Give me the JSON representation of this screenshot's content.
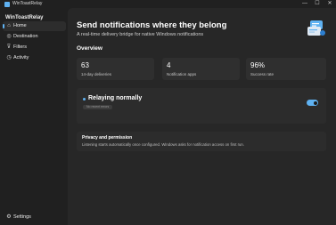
{
  "window": {
    "title": "WinToastRelay",
    "minimize_glyph": "—",
    "maximize_glyph": "☐",
    "close_glyph": "✕"
  },
  "sidebar": {
    "brand": "WinToastRelay",
    "items": [
      {
        "label": "Home",
        "icon": "home-icon",
        "glyph": "⌂",
        "active": true
      },
      {
        "label": "Destination",
        "icon": "globe-icon",
        "glyph": "◎"
      },
      {
        "label": "Filters",
        "icon": "filter-icon",
        "glyph": "⊽"
      },
      {
        "label": "Activity",
        "icon": "activity-icon",
        "glyph": "◷"
      }
    ],
    "footer": {
      "label": "Settings",
      "icon": "gear-icon",
      "glyph": "⚙"
    }
  },
  "main": {
    "headline": "Send notifications where they belong",
    "subhead": "A real-time delivery bridge for native Windows notifications",
    "overview_title": "Overview",
    "stats": [
      {
        "value": "63",
        "caption": "14-day deliveries"
      },
      {
        "value": "4",
        "caption": "Notification apps"
      },
      {
        "value": "96%",
        "caption": "Success rate"
      }
    ],
    "status": {
      "title": "Relaying normally",
      "pill": "No recent errors",
      "toggle_on": true
    },
    "privacy": {
      "title": "Privacy and permission",
      "body": "Listening starts automatically once configured. Windows asks for notification access on first run."
    }
  },
  "colors": {
    "accent": "#5fb2f2",
    "background": "#202020",
    "content": "#272727",
    "card": "#2f2f2f"
  }
}
